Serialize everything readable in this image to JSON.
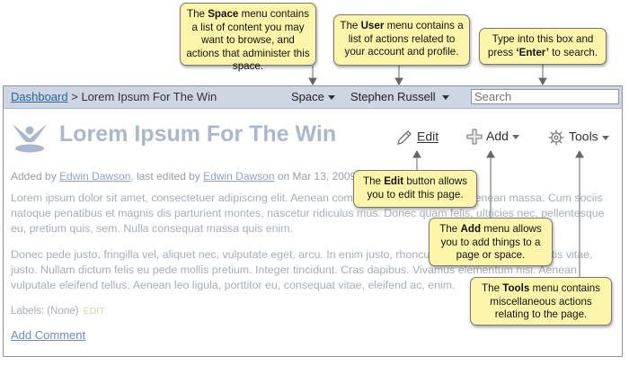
{
  "topbar": {
    "breadcrumb_link": "Dashboard",
    "breadcrumb_sep": " > ",
    "breadcrumb_current": "Lorem Ipsum For The Win",
    "space_menu": "Space",
    "user_menu": "Stephen Russell",
    "search_placeholder": "Search"
  },
  "page": {
    "title": "Lorem Ipsum For The Win",
    "actions": {
      "edit": "Edit",
      "add": "Add",
      "tools": "Tools"
    },
    "meta": {
      "added_by_prefix": "Added by ",
      "author": "Edwin Dawson",
      "edited_mid": ", last edited by ",
      "editor": "Edwin Dawson",
      "date": " on Mar 13, 2009"
    },
    "paragraphs": [
      "Lorem ipsum dolor sit amet, consectetuer adipiscing elit. Aenean commodo ligula eget dolor. Aenean massa. Cum sociis natoque penatibus et magnis dis parturient montes, nascetur ridiculus mus. Donec quam felis, ultricies nec, pellentesque eu, pretium quis, sem. Nulla consequat massa quis enim.",
      "Donec pede justo, fringilla vel, aliquet nec, vulputate eget, arcu. In enim justo, rhoncus ut, imperdiet a, venenatis vitae, justo. Nullam dictum felis eu pede mollis pretium. Integer tincidunt. Cras dapibus. Vivamus elementum nisi. Aenean vulputate eleifend tellus. Aenean leo ligula, porttitor eu, consequat vitae, eleifend ac, enim."
    ],
    "labels_prefix": "Labels:",
    "labels_value": "(None)",
    "labels_edit": "EDIT",
    "add_comment": "Add Comment"
  },
  "callouts": {
    "space": {
      "before": "The ",
      "bold": "Space",
      "after": " menu contains a list of content you may want to browse, and actions that administer this space."
    },
    "user": {
      "before": "The ",
      "bold": "User",
      "after": " menu contains a list of actions related to your account and profile."
    },
    "search": {
      "before": "Type into this box and press ",
      "bold": "‘Enter’",
      "after": " to search."
    },
    "edit": {
      "before": "The ",
      "bold": "Edit",
      "after": " button allows you to edit this page."
    },
    "add": {
      "before": "The ",
      "bold": "Add",
      "after": " menu allows you to add things to a page or space."
    },
    "tools": {
      "before": "The ",
      "bold": "Tools",
      "after": " menu contains miscellaneous actions relating to the page."
    }
  },
  "colors": {
    "topbar_bg": "#cdd6e2",
    "title": "#a9b8cd",
    "callout_bg": "#fdf5a9",
    "link": "#2e64a4"
  },
  "icons": [
    "confluence-logo-icon",
    "pencil-icon",
    "plus-icon",
    "gear-icon",
    "caret-down-icon",
    "arrow-pointer-icon"
  ]
}
